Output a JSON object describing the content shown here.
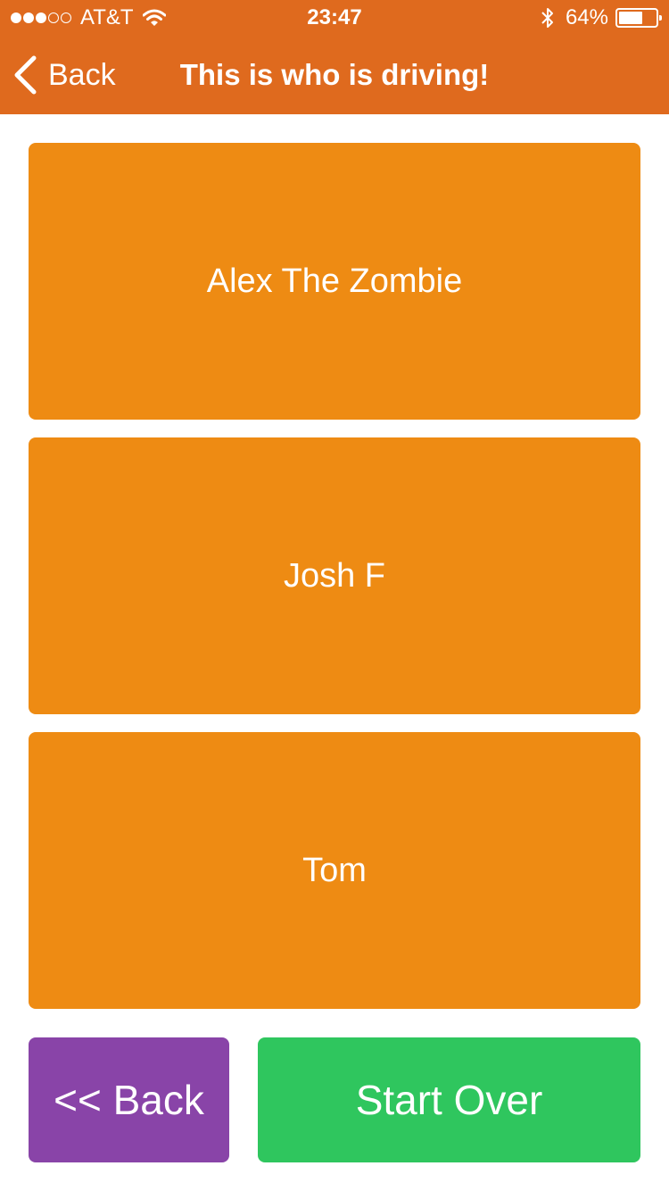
{
  "status_bar": {
    "carrier": "AT&T",
    "signal_full": 3,
    "signal_empty": 2,
    "time": "23:47",
    "battery_percent_label": "64%",
    "battery_level": 0.64,
    "icons": [
      "signal-dots",
      "wifi-icon",
      "bluetooth-icon",
      "battery-icon"
    ]
  },
  "nav": {
    "back_label": "Back",
    "title": "This is who is driving!",
    "back_icon": "chevron-left-icon"
  },
  "drivers": [
    {
      "name": "Alex The Zombie"
    },
    {
      "name": "Josh F"
    },
    {
      "name": "Tom"
    }
  ],
  "footer": {
    "back_label": "<< Back",
    "start_over_label": "Start Over"
  },
  "colors": {
    "nav_background": "#df6a1e",
    "card_background": "#ee8b13",
    "back_button": "#8944a8",
    "start_over_button": "#2fc65e"
  }
}
